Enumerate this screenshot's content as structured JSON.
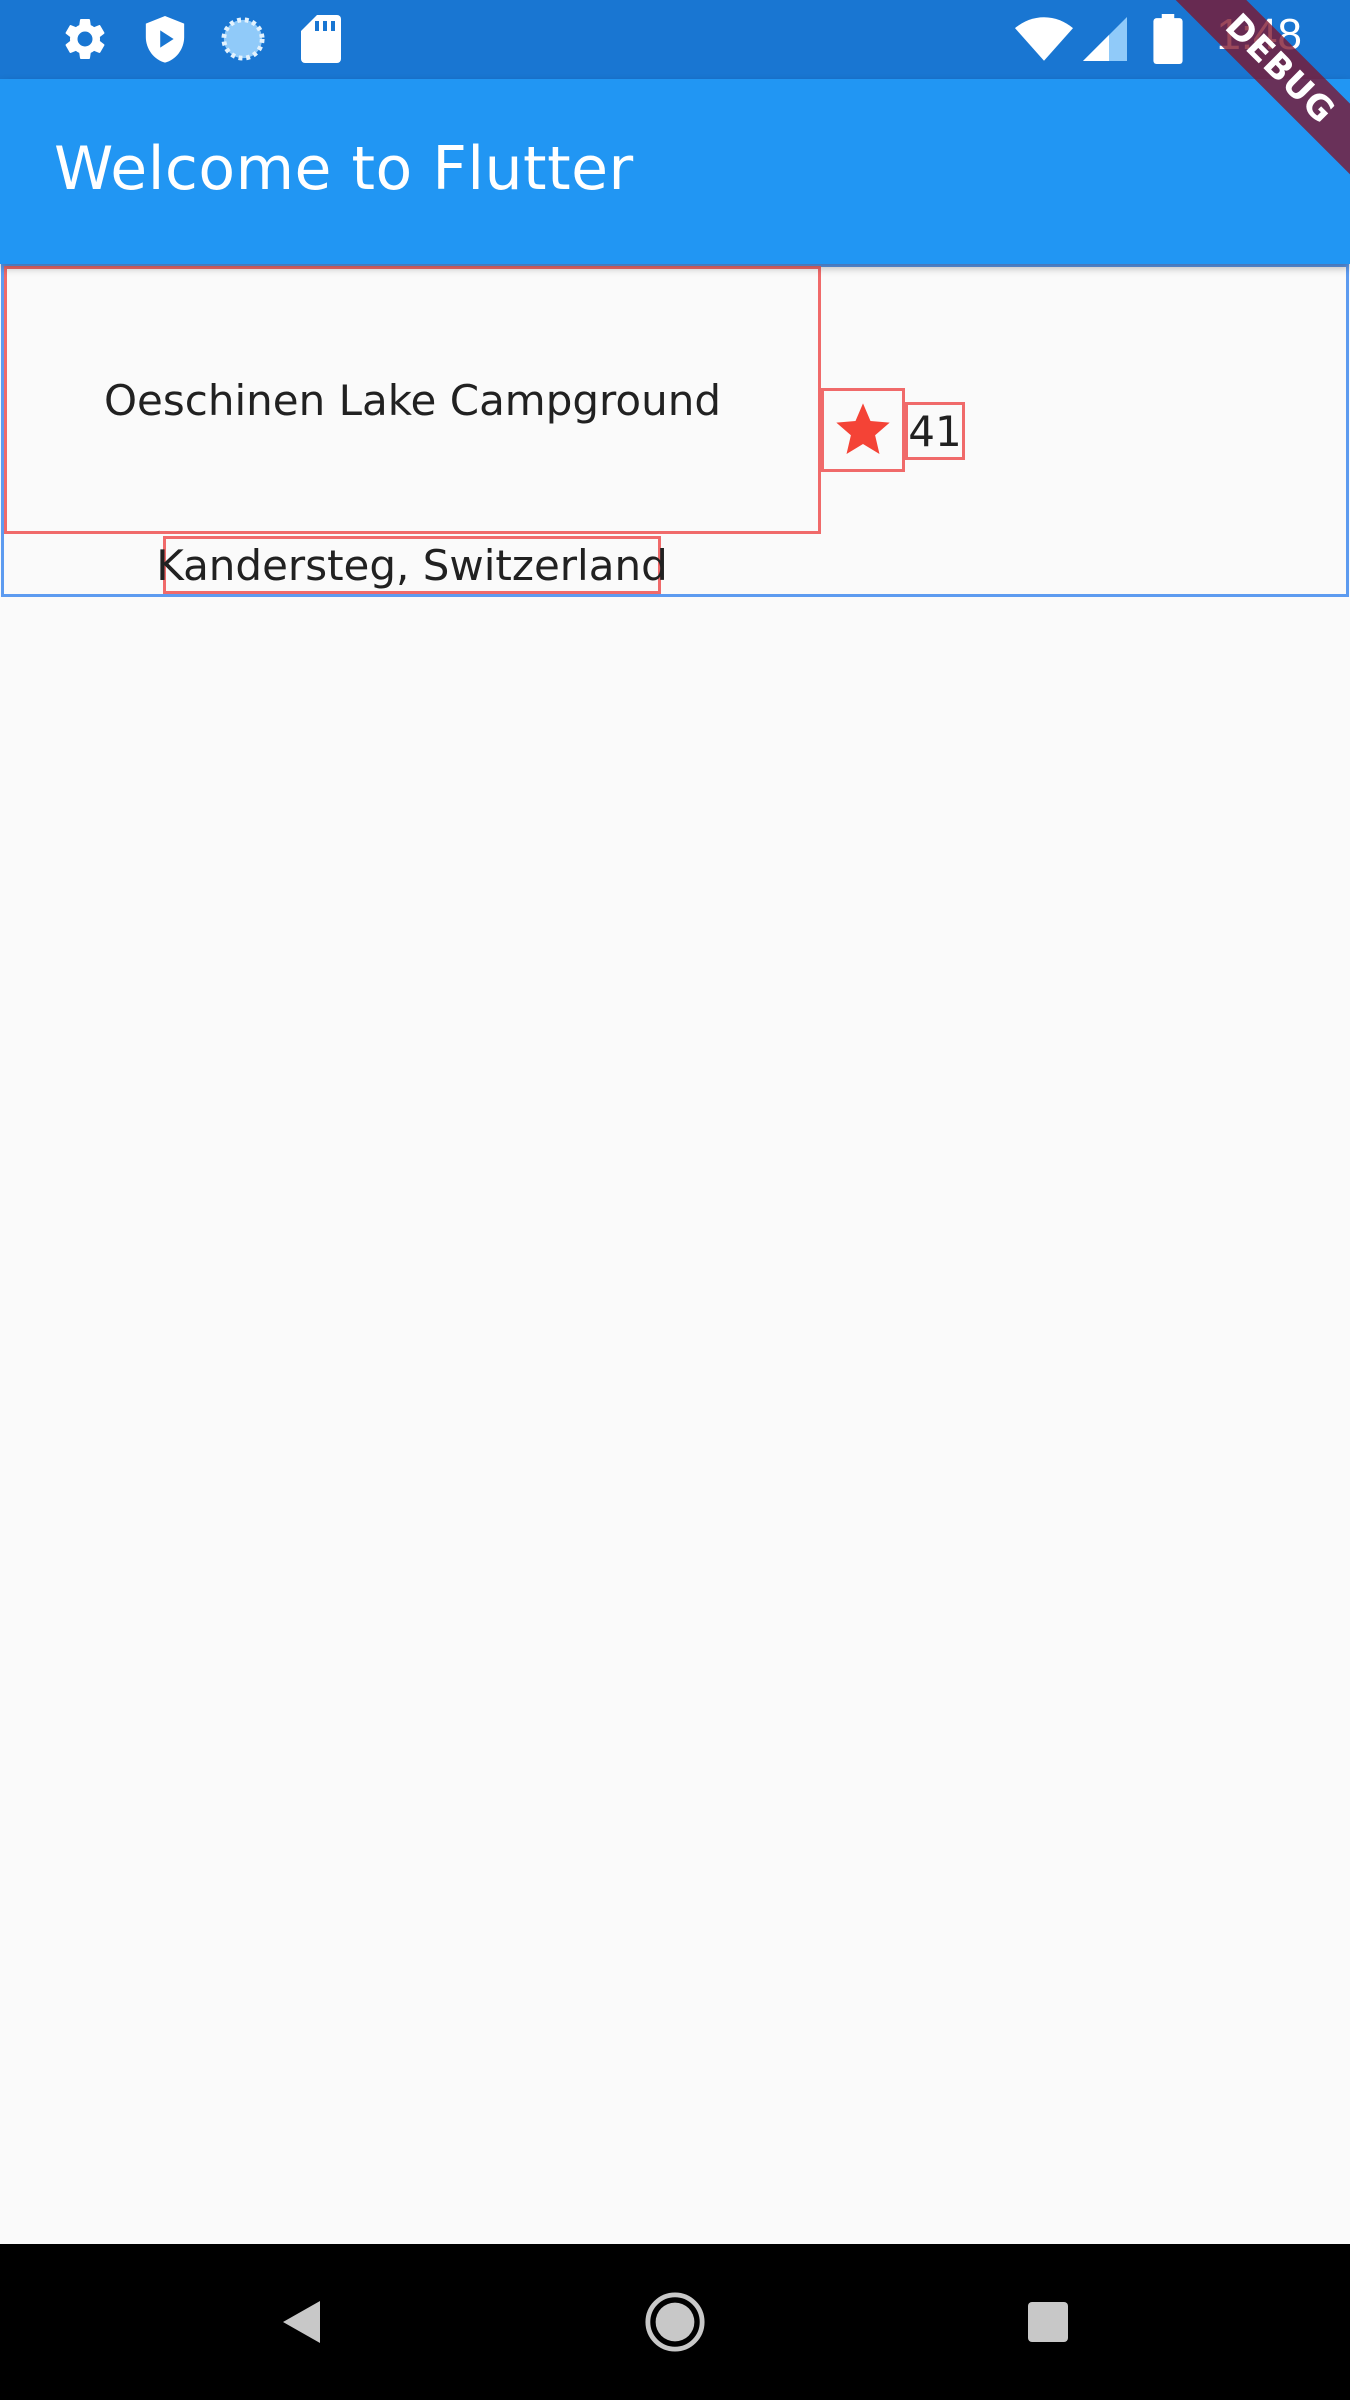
{
  "status_bar": {
    "time": "1:48",
    "left_icons": [
      "settings-icon",
      "shield-play-icon",
      "loading-circle-icon",
      "sd-card-icon"
    ],
    "right_icons": [
      "wifi-icon",
      "cellular-signal-icon",
      "battery-icon"
    ],
    "color": "#1976d2"
  },
  "debug_banner": {
    "label": "DEBUG"
  },
  "app_bar": {
    "title": "Welcome to Flutter",
    "color": "#2196f3"
  },
  "content": {
    "title": "Oeschinen Lake Campground",
    "subtitle": "Kandersteg, Switzerland",
    "star_icon": "star-icon",
    "star_color": "#f44336",
    "count": "41",
    "debug_outline_color": "#f06a6a",
    "outer_outline_color": "#5d9bf0"
  },
  "nav_bar": {
    "buttons": [
      "back-icon",
      "home-icon",
      "recents-icon"
    ]
  }
}
